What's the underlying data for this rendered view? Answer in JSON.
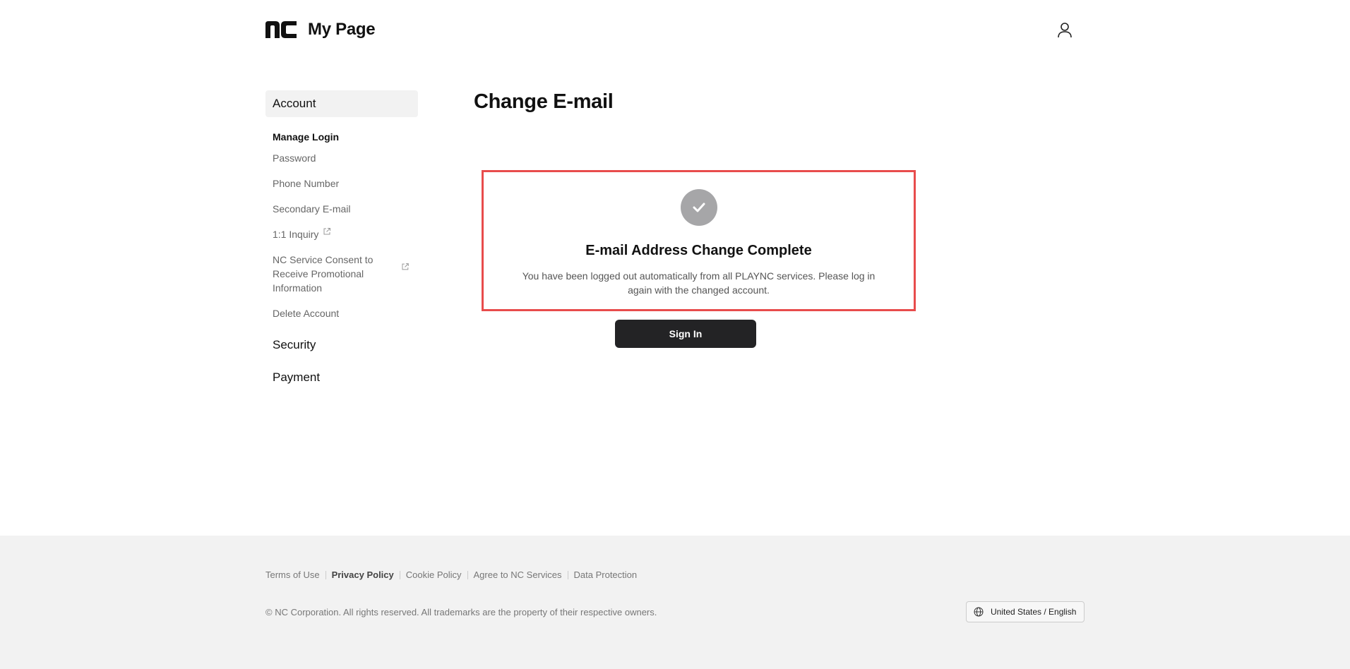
{
  "header": {
    "logo_text": "NC",
    "title": "My Page",
    "user_icon": "user-icon"
  },
  "sidebar": {
    "sections": [
      {
        "label": "Account",
        "active": true
      },
      {
        "label": "Security",
        "active": false
      },
      {
        "label": "Payment",
        "active": false
      }
    ],
    "group_title": "Manage Login",
    "items": [
      {
        "label": "Password"
      },
      {
        "label": "Phone Number"
      },
      {
        "label": "Secondary E-mail"
      },
      {
        "label": "1:1 Inquiry",
        "icon": "external-link-icon"
      },
      {
        "label": "NC Service Consent to Receive Promotional Information",
        "icon": "external-link-icon"
      },
      {
        "label": "Delete Account"
      }
    ]
  },
  "main": {
    "title": "Change E-mail",
    "result": {
      "icon": "check-circle-icon",
      "title": "E-mail Address Change Complete",
      "message": "You have been logged out automatically from all PLAYNC services. Please log in again with the changed account."
    },
    "sign_in_label": "Sign In",
    "highlight_color": "#e84c4c"
  },
  "footer": {
    "links": [
      "Terms of Use",
      "Privacy Policy",
      "Cookie Policy",
      "Agree to NC Services",
      "Data Protection"
    ],
    "copyright": "© NC Corporation. All rights reserved. All trademarks are the property of their respective owners.",
    "language": "United States / English",
    "language_icon": "globe-icon"
  }
}
